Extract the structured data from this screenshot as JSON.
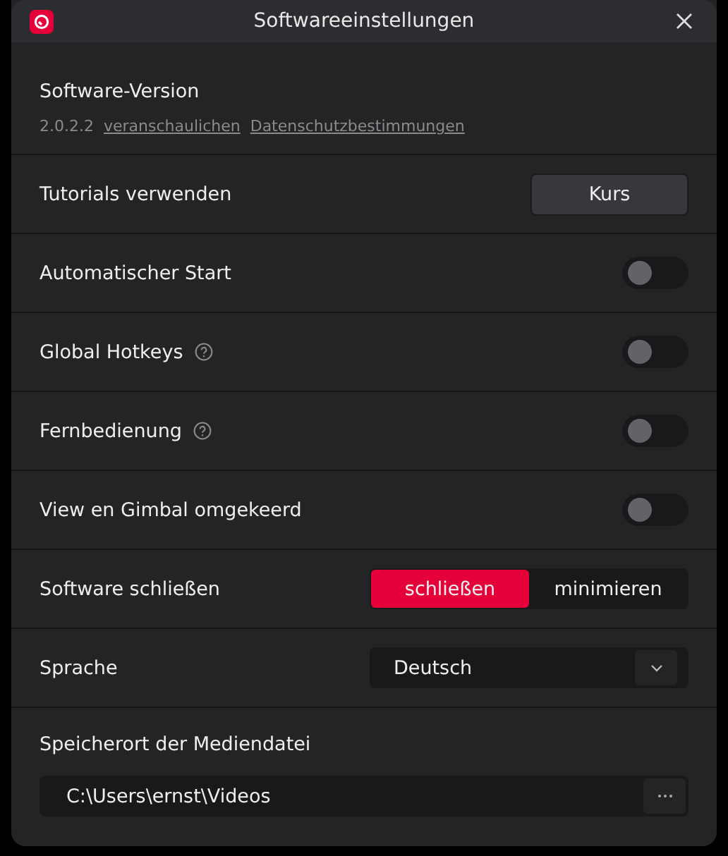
{
  "window": {
    "title": "Softwareeinstellungen"
  },
  "version": {
    "heading": "Software-Version",
    "number": "2.0.2.2",
    "links": [
      "veranschaulichen",
      "Datenschutzbestimmungen"
    ]
  },
  "settings": [
    {
      "kind": "button",
      "label": "Tutorials verwenden",
      "button": "Kurs"
    },
    {
      "kind": "toggle",
      "label": "Automatischer Start",
      "help": false,
      "on": false
    },
    {
      "kind": "toggle",
      "label": "Global Hotkeys",
      "help": true,
      "on": false
    },
    {
      "kind": "toggle",
      "label": "Fernbedienung",
      "help": true,
      "on": false
    },
    {
      "kind": "toggle",
      "label": "View en Gimbal omgekeerd",
      "help": false,
      "on": false
    },
    {
      "kind": "segmented",
      "label": "Software schließen",
      "options": [
        {
          "label": "schließen",
          "selected": true
        },
        {
          "label": "minimieren",
          "selected": false
        }
      ]
    },
    {
      "kind": "dropdown",
      "label": "Sprache",
      "value": "Deutsch"
    }
  ],
  "media_path": {
    "label": "Speicherort der Mediendatei",
    "value": "C:\\Users\\ernst\\Videos"
  }
}
